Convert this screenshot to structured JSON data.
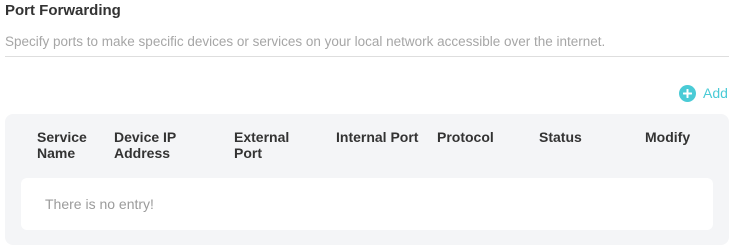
{
  "header": {
    "title": "Port Forwarding",
    "subtitle": "Specify ports to make specific devices or services on your local network accessible over the internet."
  },
  "toolbar": {
    "add_label": "Add",
    "add_icon": "plus-circle-icon",
    "accent_color": "#4acbd6"
  },
  "table": {
    "columns": {
      "service_name": "Service Name",
      "device_ip": "Device IP Address",
      "external_port": "External Port",
      "internal_port": "Internal Port",
      "protocol": "Protocol",
      "status": "Status",
      "modify": "Modify"
    },
    "rows": [],
    "empty_text": "There is no entry!"
  }
}
